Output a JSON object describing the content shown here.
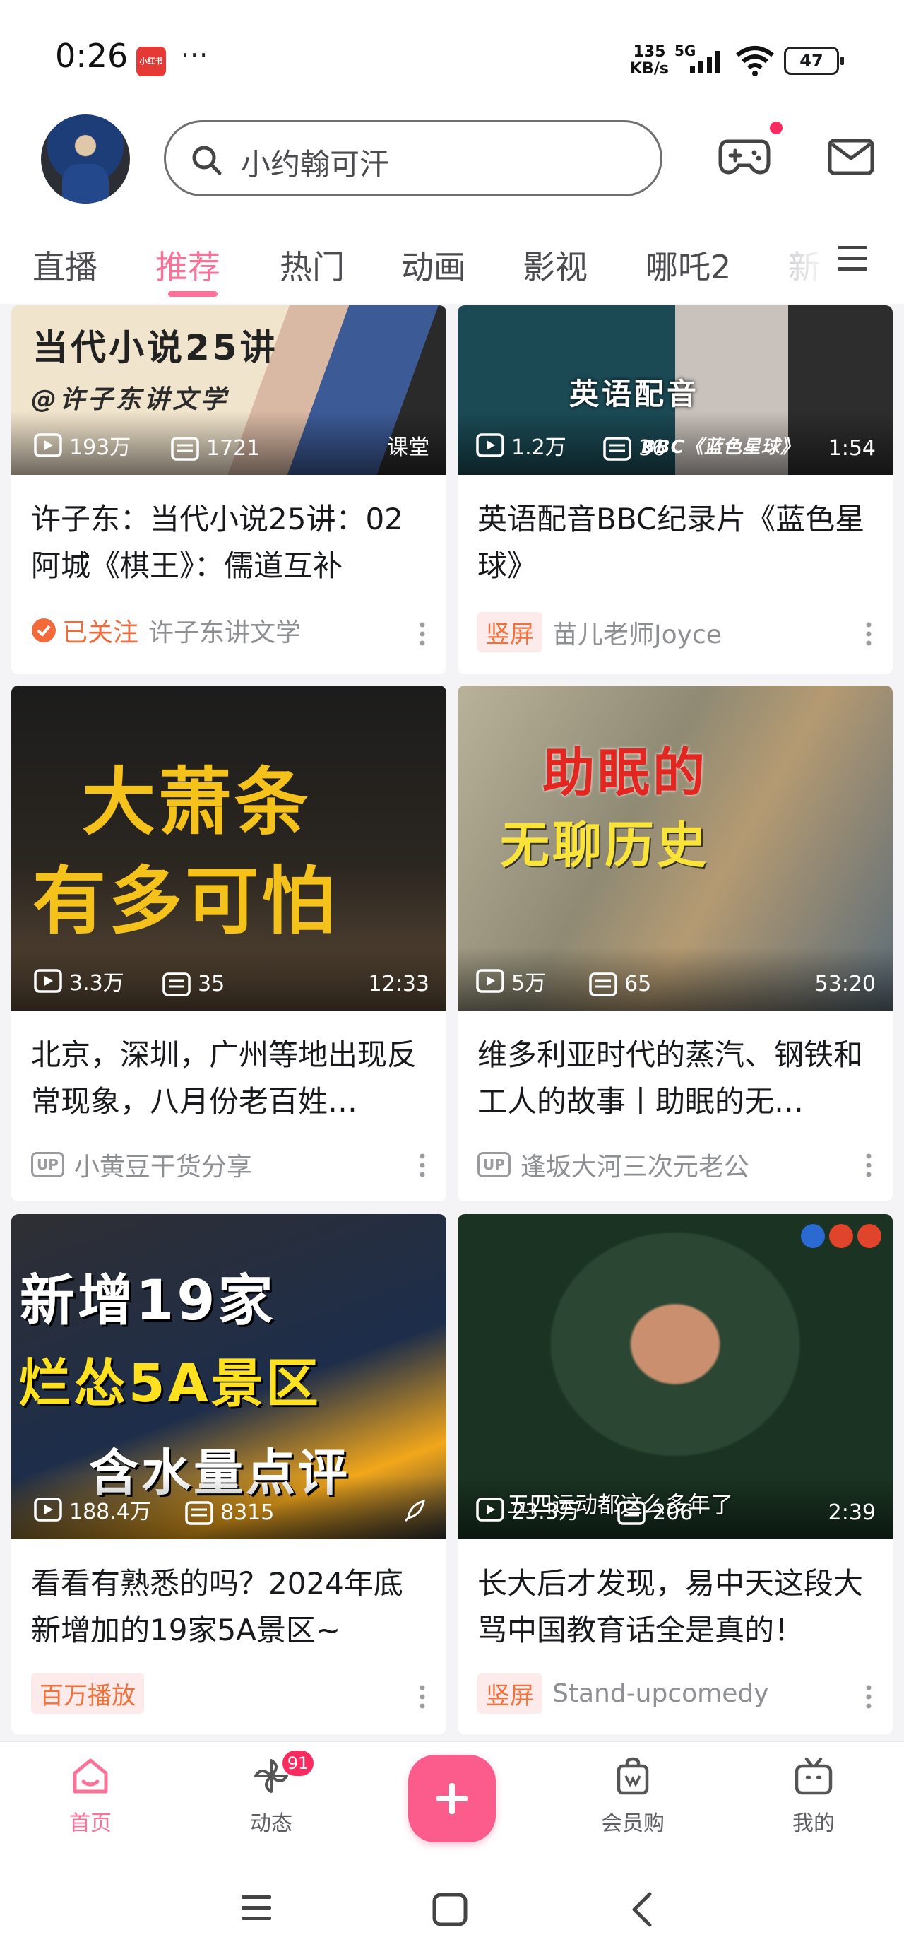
{
  "status_bar": {
    "time": "0:26",
    "app_icon_label": "小红书",
    "more": "···",
    "net_speed_value": "135",
    "net_speed_unit": "KB/s",
    "network": "5G",
    "battery": "47"
  },
  "header": {
    "search_placeholder": "小约翰可汗"
  },
  "tabs": [
    {
      "label": "直播"
    },
    {
      "label": "推荐"
    },
    {
      "label": "热门"
    },
    {
      "label": "动画"
    },
    {
      "label": "影视"
    },
    {
      "label": "哪吒2"
    },
    {
      "label": "新"
    }
  ],
  "active_tab": "推荐",
  "feed": [
    {
      "views": "193万",
      "danmaku": "1721",
      "corner": "课堂",
      "thumb_text": "当代小说25讲",
      "thumb_watermark": "@许子东讲文学",
      "title": "许子东：当代小说25讲：02阿城《棋王》：儒道互补",
      "followed_label": "已关注",
      "author": "许子东讲文学"
    },
    {
      "views": "1.2万",
      "danmaku": "36",
      "duration": "1:54",
      "thumb_text": "英语配音",
      "thumb_caption": "BBC《蓝色星球》",
      "title": "英语配音BBC纪录片《蓝色星球》",
      "tag": "竖屏",
      "author": "苗儿老师Joyce"
    },
    {
      "views": "3.3万",
      "danmaku": "35",
      "duration": "12:33",
      "thumb_line1": "大萧条",
      "thumb_line2": "有多可怕",
      "title": "北京，深圳，广州等地出现反常现象，八月份老百姓…",
      "up_label": "UP",
      "author": "小黄豆干货分享"
    },
    {
      "views": "5万",
      "danmaku": "65",
      "duration": "53:20",
      "thumb_line1": "助眠的",
      "thumb_line2": "无聊历史",
      "title": "维多利亚时代的蒸汽、钢铁和工人的故事丨助眠的无…",
      "up_label": "UP",
      "author": "逢坂大河三次元老公"
    },
    {
      "views": "188.4万",
      "danmaku": "8315",
      "thumb_line1": "新增19家",
      "thumb_line2": "烂怂5A景区",
      "thumb_line3": "含水量点评",
      "title": "看看有熟悉的吗？2024年底新增加的19家5A景区~",
      "tag": "百万播放"
    },
    {
      "views": "23.3万",
      "danmaku": "206",
      "duration": "2:39",
      "thumb_subtitle": "五四运动都这么多年了",
      "title": "长大后才发现，易中天这段大骂中国教育话全是真的！",
      "tag": "竖屏",
      "author": "Stand-upcomedy"
    }
  ],
  "bottom_nav": {
    "home": "首页",
    "dynamic": "动态",
    "dynamic_badge": "91",
    "vip": "会员购",
    "mine": "我的"
  },
  "colors": {
    "accent": "#fb7299",
    "orange": "#f0723a"
  }
}
